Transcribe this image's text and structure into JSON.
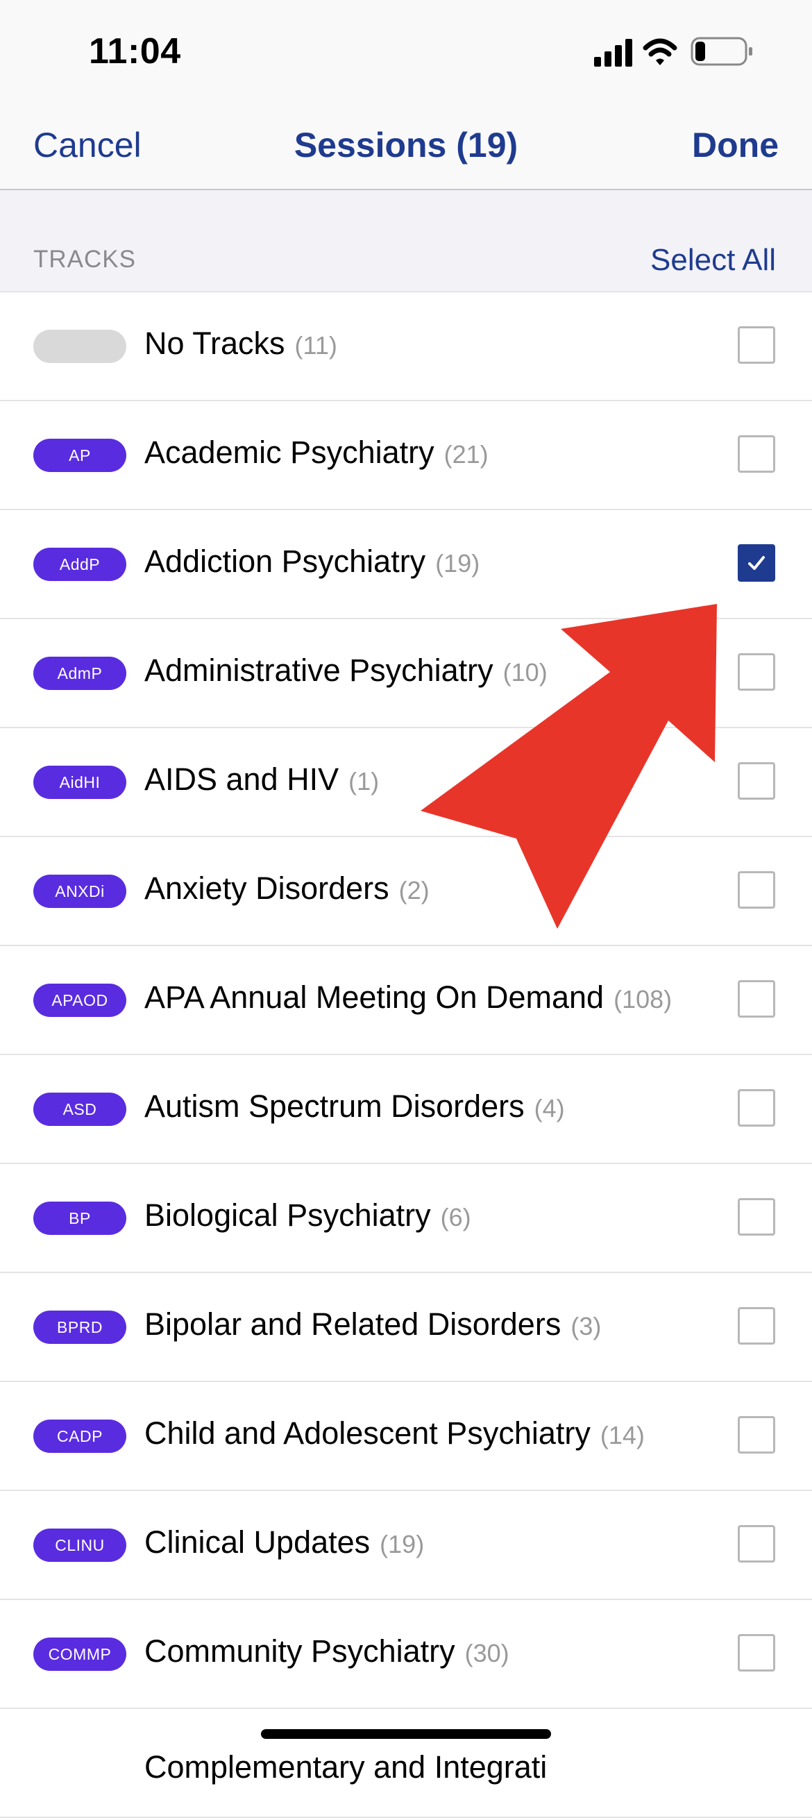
{
  "status_bar": {
    "time": "11:04"
  },
  "nav": {
    "cancel_label": "Cancel",
    "title": "Sessions (19)",
    "done_label": "Done"
  },
  "section": {
    "title": "TRACKS",
    "select_all_label": "Select All"
  },
  "tracks": [
    {
      "badge": "",
      "name": "No Tracks",
      "count": "(11)",
      "checked": false
    },
    {
      "badge": "AP",
      "name": "Academic Psychiatry",
      "count": "(21)",
      "checked": false
    },
    {
      "badge": "AddP",
      "name": "Addiction Psychiatry",
      "count": "(19)",
      "checked": true
    },
    {
      "badge": "AdmP",
      "name": "Administrative Psychiatry",
      "count": "(10)",
      "checked": false
    },
    {
      "badge": "AidHI",
      "name": "AIDS and HIV",
      "count": "(1)",
      "checked": false
    },
    {
      "badge": "ANXDi",
      "name": "Anxiety Disorders",
      "count": "(2)",
      "checked": false
    },
    {
      "badge": "APAOD",
      "name": "APA Annual Meeting On Demand",
      "count": "(108)",
      "checked": false
    },
    {
      "badge": "ASD",
      "name": "Autism Spectrum Disorders",
      "count": "(4)",
      "checked": false
    },
    {
      "badge": "BP",
      "name": "Biological Psychiatry",
      "count": "(6)",
      "checked": false
    },
    {
      "badge": "BPRD",
      "name": "Bipolar and Related Disorders",
      "count": "(3)",
      "checked": false
    },
    {
      "badge": "CADP",
      "name": "Child and Adolescent Psychiatry",
      "count": "(14)",
      "checked": false
    },
    {
      "badge": "CLINU",
      "name": "Clinical Updates",
      "count": "(19)",
      "checked": false
    },
    {
      "badge": "COMMP",
      "name": "Community Psychiatry",
      "count": "(30)",
      "checked": false
    },
    {
      "badge": "",
      "name": "Complementary and Integrati",
      "count": "",
      "checked": false
    }
  ],
  "colors": {
    "accent": "#1f3b8f",
    "badge": "#5a2ce0",
    "annotation_arrow": "#e8352a"
  },
  "icons": {
    "signal": "cellular-signal-icon",
    "wifi": "wifi-icon",
    "battery": "battery-icon",
    "check": "checkmark-icon",
    "annotation": "red-arrow-annotation"
  }
}
